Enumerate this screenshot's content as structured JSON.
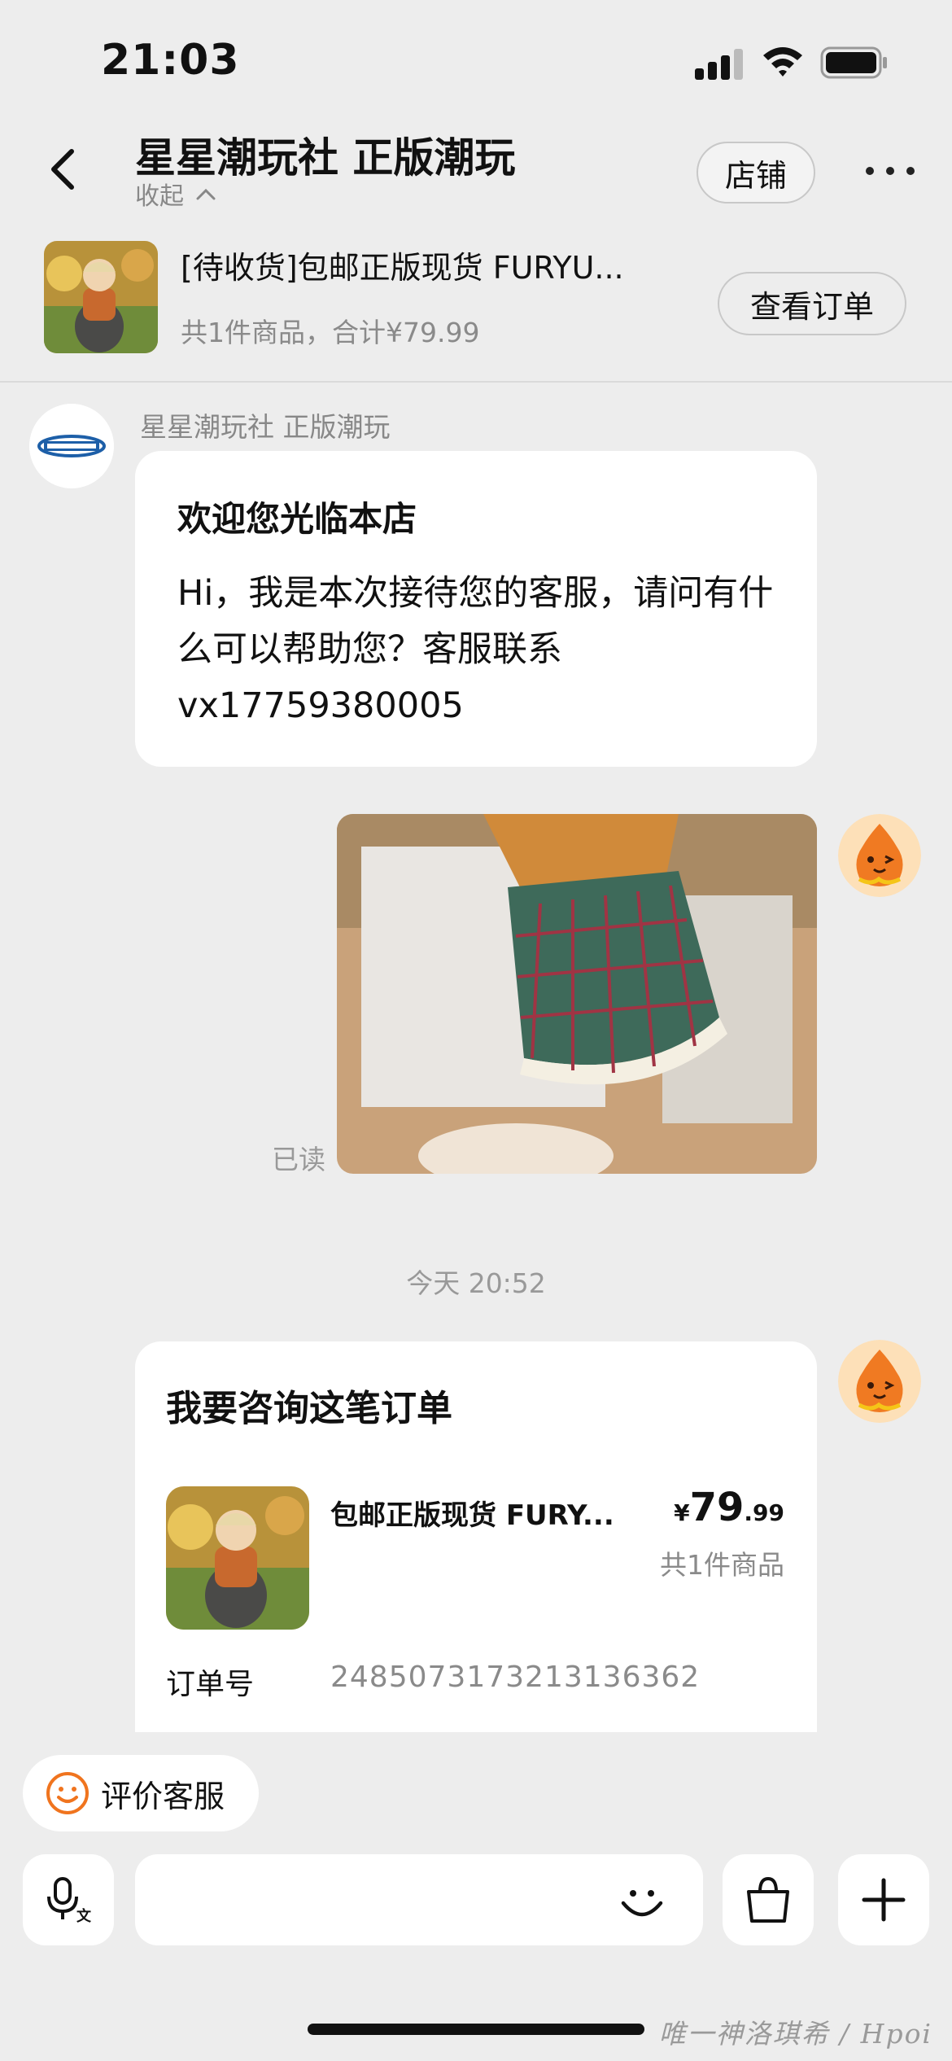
{
  "status_bar": {
    "time": "21:03"
  },
  "header": {
    "shop_name": "星星潮玩社 正版潮玩",
    "collapse_label": "收起",
    "store_button": "店铺"
  },
  "order_bar": {
    "title": "[待收货]包邮正版现货 FURYU...",
    "summary": "共1件商品，合计¥79.99",
    "view_order_button": "查看订单"
  },
  "chat": {
    "shop_sender_name": "星星潮玩社 正版潮玩",
    "welcome_title": "欢迎您光临本店",
    "welcome_text": "Hi，我是本次接待您的客服，请问有什么可以帮助您？客服联系 vx17759380005",
    "read_status": "已读",
    "time_divider": "今天 20:52",
    "order_card": {
      "title": "我要咨询这笔订单",
      "product_name": "包邮正版现货 FURY...",
      "price_currency": "¥",
      "price_integer": "79",
      "price_decimal": ".99",
      "item_count": "共1件商品",
      "order_no_label": "订单号",
      "order_no": "2485073173213136362"
    }
  },
  "rate_service_button": "评价客服",
  "input": {
    "placeholder": ""
  },
  "watermark": "唯一神洛琪希 / Hpoi",
  "icons": {
    "back": "chevron-left-icon",
    "more": "more-dots-icon",
    "voice": "voice-input-icon",
    "emoji": "smile-icon",
    "bag": "shopping-bag-icon",
    "plus": "plus-icon",
    "rate": "smile-face-icon"
  },
  "colors": {
    "accent_orange": "#f0741e",
    "background": "#ededed"
  }
}
